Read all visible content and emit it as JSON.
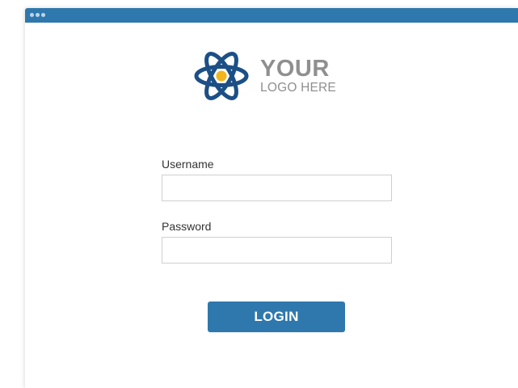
{
  "window": {
    "titlebar_color": "#2f78ad",
    "window_controls": [
      "dot",
      "dot",
      "dot"
    ]
  },
  "logo": {
    "icon": "atom-icon",
    "line1": "YOUR",
    "line2": "LOGO HERE",
    "icon_colors": {
      "orbit": "#1c4f86",
      "nucleus": "#f2b51d"
    },
    "text_color": "#8f8f8f"
  },
  "form": {
    "username": {
      "label": "Username",
      "value": "",
      "placeholder": ""
    },
    "password": {
      "label": "Password",
      "value": "",
      "placeholder": ""
    },
    "login_label": "LOGIN",
    "accent_color": "#2f78ad"
  }
}
